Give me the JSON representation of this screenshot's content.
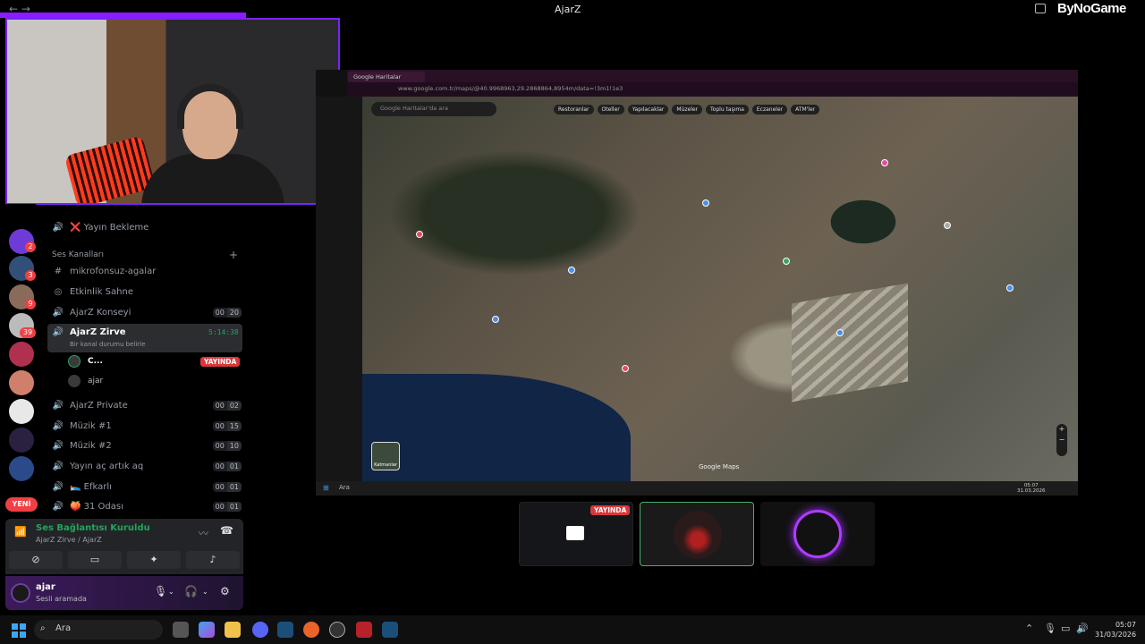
{
  "window": {
    "title": "AjarZ",
    "brand": "ByNoGame"
  },
  "channels": {
    "top_item": "❌ Yayın Bekleme",
    "category": "Ses Kanalları",
    "items": [
      {
        "icon": "#",
        "name": "mikrofonsuz-agalar"
      },
      {
        "icon": "◎",
        "name": "Etkinlik Sahne"
      },
      {
        "icon": "🔊",
        "name": "AjarZ Konseyi",
        "count": [
          "00",
          "20"
        ]
      },
      {
        "icon": "🔊",
        "name": "AjarZ Zirve",
        "timer": "5:14:38",
        "status": "Bir kanal durumu belirle"
      },
      {
        "icon": "🔊",
        "name": "AjarZ Private",
        "count": [
          "00",
          "02"
        ]
      },
      {
        "icon": "🔊",
        "name": "Müzik #1",
        "count": [
          "00",
          "15"
        ]
      },
      {
        "icon": "🔊",
        "name": "Müzik #2",
        "count": [
          "00",
          "10"
        ]
      },
      {
        "icon": "🔊",
        "name": "Yayın aç artık aq",
        "count": [
          "00",
          "01"
        ]
      },
      {
        "icon": "🔊",
        "name": "🛌 Efkarlı",
        "count": [
          "00",
          "01"
        ]
      },
      {
        "icon": "🔊",
        "name": "🍑 31 Odası",
        "count": [
          "00",
          "01"
        ]
      }
    ],
    "users": [
      {
        "name": "C...",
        "badge": "YAYINDA"
      },
      {
        "name": "ajar"
      }
    ],
    "new_badge": "YENİ"
  },
  "servers": {
    "badges": [
      "2",
      "3",
      "9",
      "39"
    ]
  },
  "voice": {
    "title": "Ses Bağlantısı Kuruldu",
    "subtitle": "AjarZ Zirve / AjarZ"
  },
  "user": {
    "name": "ajar",
    "status": "Sesli aramada"
  },
  "share": {
    "tab_title": "Google Haritalar",
    "url": "www.google.com.tr/maps/@40.9968963,29.2868864,8954m/data=!3m1!1e3",
    "search_placeholder": "Google Haritalar'da ara",
    "chips": [
      "Restoranlar",
      "Oteller",
      "Yapılacaklar",
      "Müzeler",
      "Toplu taşıma",
      "Eczaneler",
      "ATM'ler"
    ],
    "layers": "Katmanlar",
    "map_credit": "Google Maps",
    "taskbar_search": "Ara",
    "time": "05:07",
    "date": "31.03.2026"
  },
  "thumbs": {
    "live": "YAYINDA"
  },
  "taskbar": {
    "search": "Ara",
    "time": "05:07",
    "date": "31/03/2026"
  },
  "colors": {
    "accent": "#7b22ff",
    "green": "#23a55a",
    "red": "#da373c"
  }
}
